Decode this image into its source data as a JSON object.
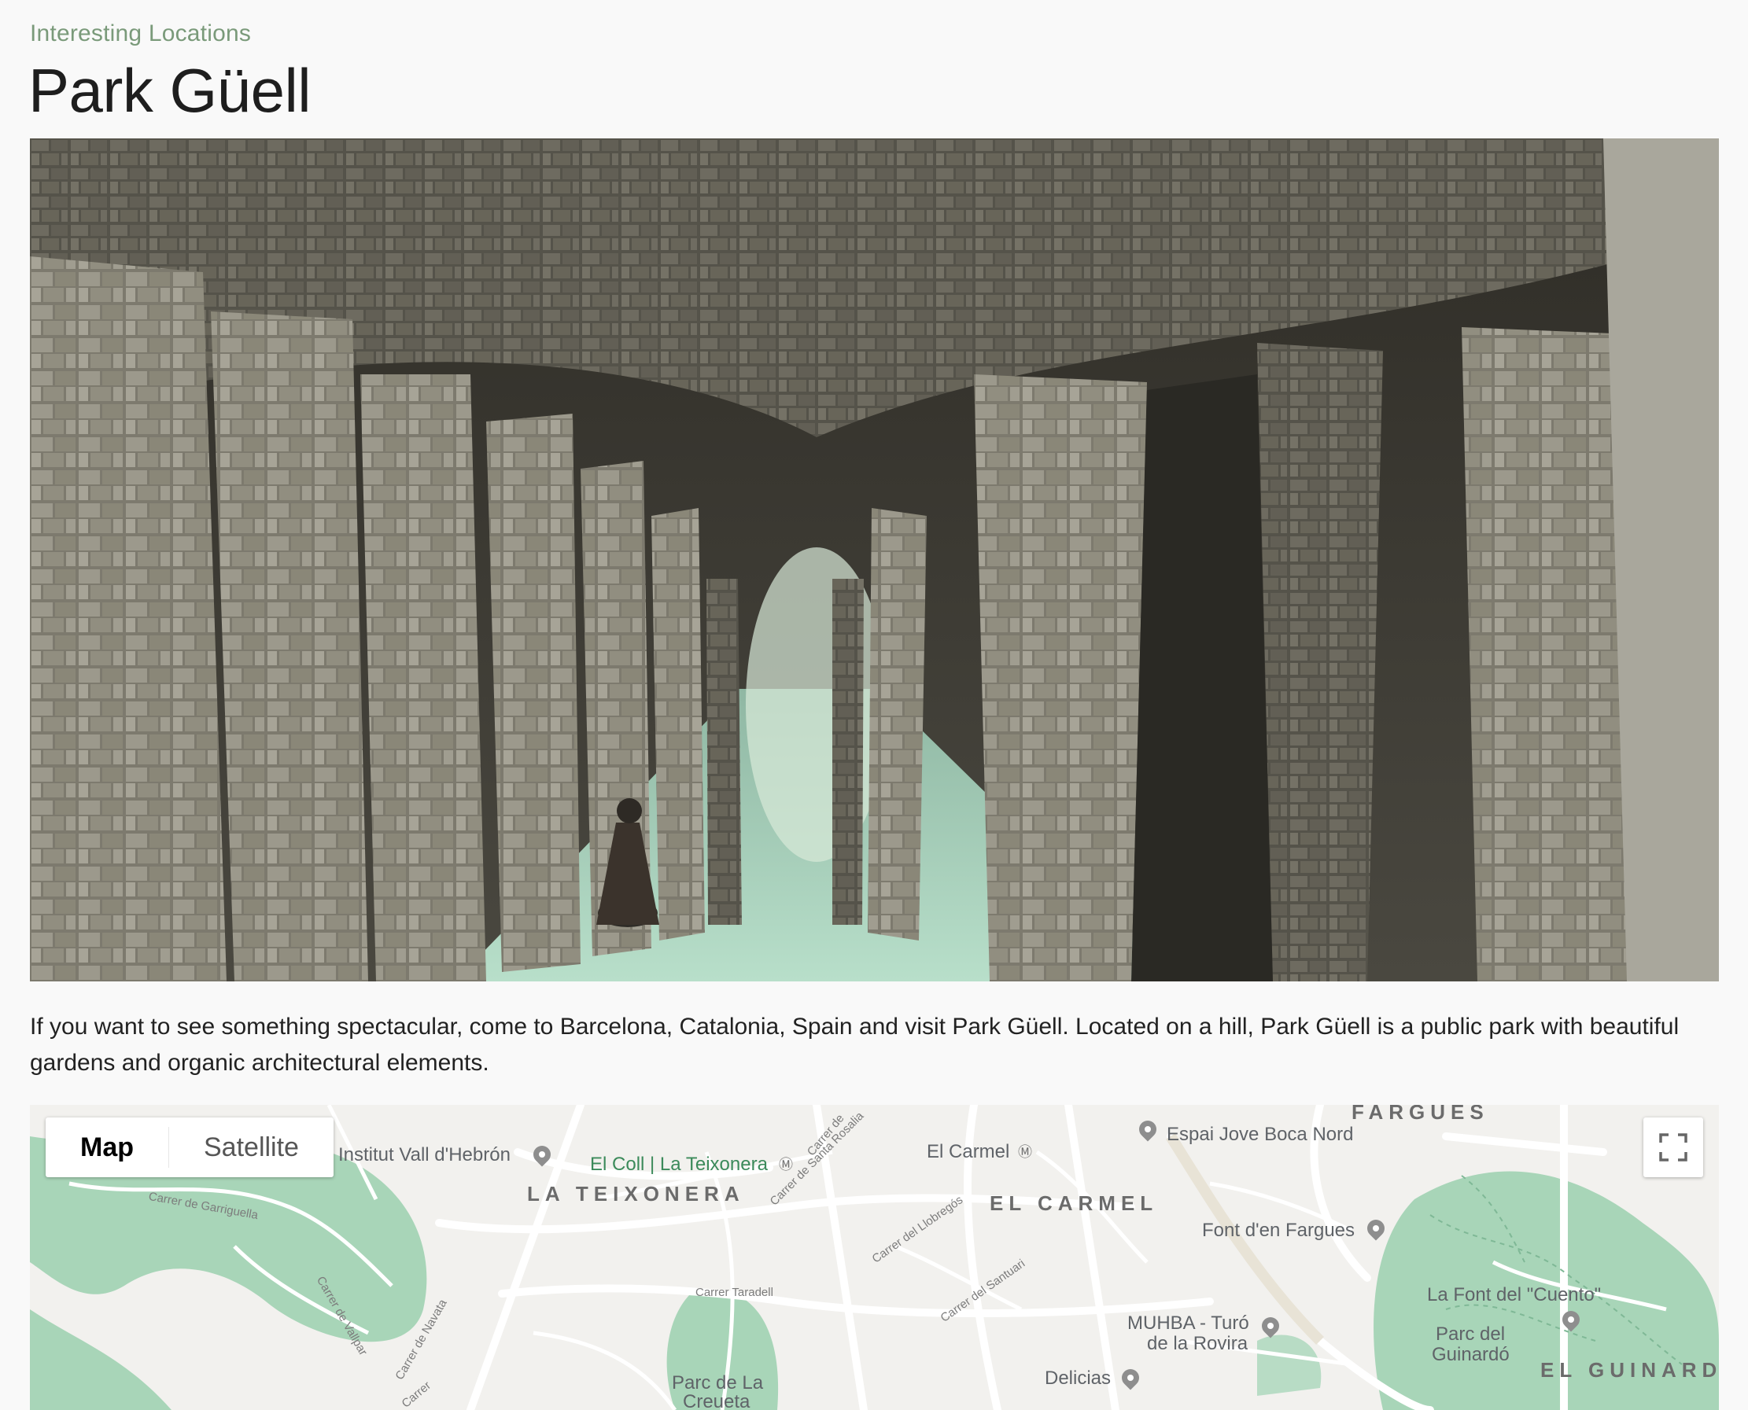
{
  "header": {
    "kicker": "Interesting Locations",
    "title": "Park Güell"
  },
  "hero": {
    "alt": "Stone colonnade of arched pillars at Park Güell"
  },
  "description": "If you want to see something spectacular, come to Barcelona, Catalonia, Spain and visit Park Güell. Located on a hill, Park Güell is a public park with beautiful gardens and organic architectural elements.",
  "map": {
    "type_controls": {
      "map_label": "Map",
      "satellite_label": "Satellite",
      "selected": "Map"
    },
    "places": {
      "institut": "Institut Vall d'Hebrón",
      "el_coll": "El Coll | La Teixonera",
      "el_carmel_station": "El Carmel",
      "espai_jove": "Espai Jove Boca Nord",
      "font_fargues": "Font d'en Fargues",
      "font_cuento": "La Font del \"Cuento\"",
      "muhba_1": "MUHBA - Turó",
      "muhba_2": "de la Rovira",
      "parc_guinardo_1": "Parc del",
      "parc_guinardo_2": "Guinardó",
      "delicias": "Delicias",
      "parc_creueta_1": "Parc de La",
      "parc_creueta_2": "Creueta"
    },
    "districts": {
      "teixonera": "LA TEIXONERA",
      "carmel": "EL CARMEL",
      "fargues": "FARGUES",
      "guinardo": "EL GUINARD"
    },
    "streets": {
      "garriguella": "Carrer de Garriguella",
      "vallpar": "Carrer de Vallpar",
      "navata": "Carrer de Navata",
      "taradell": "Carrer Taradell",
      "santa_rosalia": "Carrer de Santa Rosalia",
      "llobregos": "Carrer del Llobregós",
      "santuari": "Carrer del Santuari",
      "carrer_de": "Carrer de",
      "carrer": "Carrer"
    }
  },
  "colors": {
    "background": "#f9f9f9",
    "kicker": "#7a9a7a",
    "park_green": "#a8d5b8",
    "road": "#ffffff"
  }
}
